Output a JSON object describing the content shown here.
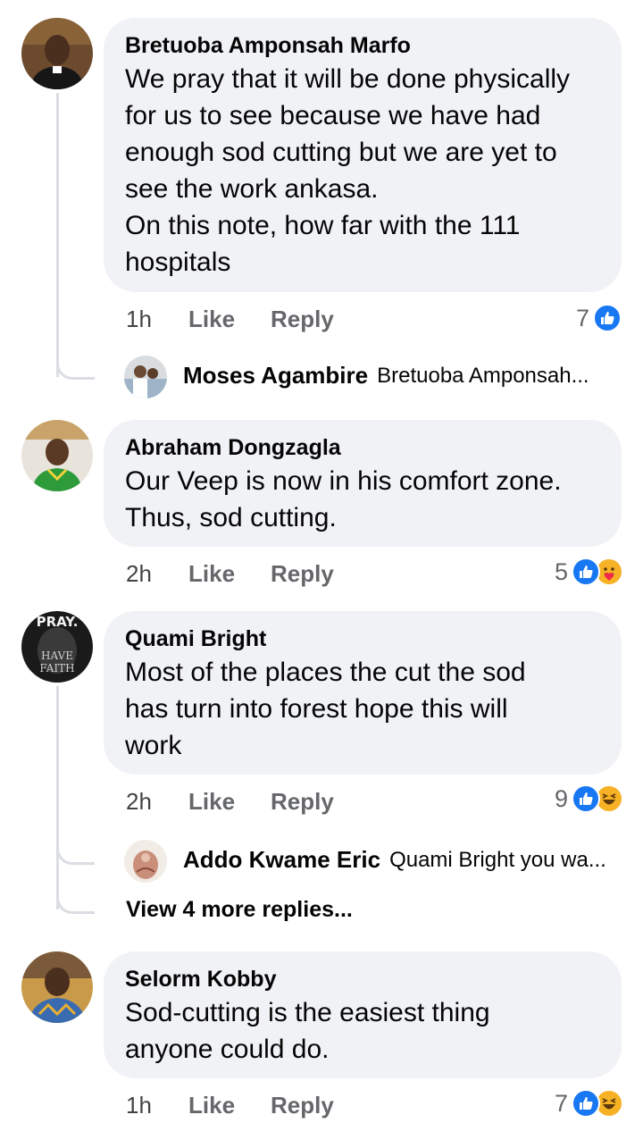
{
  "comments": [
    {
      "author": "Bretuoba Amponsah Marfo",
      "text": "We pray that it will be done physically\nfor us to see because we have had\nenough sod cutting but we are yet to\nsee the work ankasa.\nOn this note, how far with the 111\nhospitals",
      "time": "1h",
      "like_label": "Like",
      "reply_label": "Reply",
      "reaction_count": "7",
      "reactions": [
        "like-icon"
      ],
      "reply_preview": {
        "name": "Moses Agambire",
        "snippet": "Bretuoba Amponsah..."
      }
    },
    {
      "author": "Abraham Dongzagla",
      "text": "Our Veep is now in his comfort zone.\nThus, sod cutting.",
      "time": "2h",
      "like_label": "Like",
      "reply_label": "Reply",
      "reaction_count": "5",
      "reactions": [
        "like-icon",
        "care-icon"
      ]
    },
    {
      "author": "Quami Bright",
      "text": "Most of the places the cut the sod\nhas turn into forest hope this will\nwork",
      "time": "2h",
      "like_label": "Like",
      "reply_label": "Reply",
      "reaction_count": "9",
      "reactions": [
        "like-icon",
        "haha-icon"
      ],
      "reply_preview": {
        "name": "Addo Kwame Eric",
        "snippet": "Quami Bright you wa..."
      },
      "view_more": "View 4 more replies..."
    },
    {
      "author": "Selorm Kobby",
      "text": "Sod-cutting is the easiest thing\nanyone could do.",
      "time": "1h",
      "like_label": "Like",
      "reply_label": "Reply",
      "reaction_count": "7",
      "reactions": [
        "like-icon",
        "haha-icon"
      ]
    }
  ],
  "avatar_texts": {
    "quami_top": "PRAY.",
    "quami_bottom": "HAVE\nFAITH"
  },
  "colors": {
    "like_blue": "#1877f2",
    "bubble_bg": "#f0f2f5",
    "meta_gray": "#65676b",
    "emoji_yellow": "#f7b125"
  }
}
